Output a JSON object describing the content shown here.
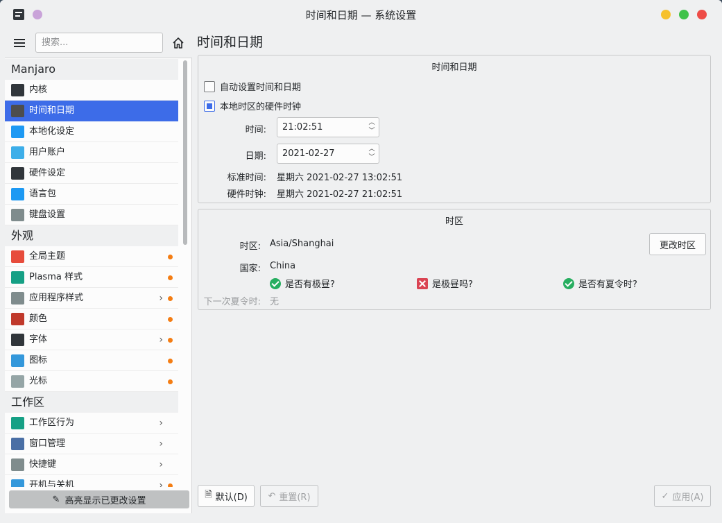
{
  "window": {
    "title": "时间和日期 — 系统设置"
  },
  "sidebar": {
    "search_placeholder": "搜索...",
    "sections": [
      {
        "header": "Manjaro",
        "items": [
          {
            "label": "内核",
            "icon": "kernel-icon",
            "color": "#31363b"
          },
          {
            "label": "时间和日期",
            "icon": "clock-icon",
            "color": "#4d4d4d",
            "selected": true
          },
          {
            "label": "本地化设定",
            "icon": "locale-chat-icon",
            "color": "#1d99f3"
          },
          {
            "label": "用户账户",
            "icon": "user-icon",
            "color": "#3daee9"
          },
          {
            "label": "硬件设定",
            "icon": "hardware-icon",
            "color": "#31363b"
          },
          {
            "label": "语言包",
            "icon": "language-chat-icon",
            "color": "#1d99f3"
          },
          {
            "label": "键盘设置",
            "icon": "keyboard-icon",
            "color": "#7f8c8d"
          }
        ]
      },
      {
        "header": "外观",
        "items": [
          {
            "label": "全局主题",
            "icon": "global-theme-icon",
            "color": "#e74c3c",
            "changed": true
          },
          {
            "label": "Plasma 样式",
            "icon": "plasma-style-icon",
            "color": "#16a085",
            "changed": true
          },
          {
            "label": "应用程序样式",
            "icon": "app-style-icon",
            "color": "#7f8c8d",
            "chevron": true,
            "changed": true
          },
          {
            "label": "颜色",
            "icon": "colors-icon",
            "color": "#c0392b",
            "changed": true
          },
          {
            "label": "字体",
            "icon": "fonts-icon",
            "color": "#31363b",
            "chevron": true,
            "changed": true
          },
          {
            "label": "图标",
            "icon": "icons-icon",
            "color": "#3498db",
            "changed": true
          },
          {
            "label": "光标",
            "icon": "cursor-icon",
            "color": "#95a5a6",
            "changed": true
          }
        ]
      },
      {
        "header": "工作区",
        "items": [
          {
            "label": "工作区行为",
            "icon": "workspace-behavior-icon",
            "color": "#16a085",
            "chevron": true
          },
          {
            "label": "窗口管理",
            "icon": "window-management-icon",
            "color": "#4a6fa5",
            "chevron": true
          },
          {
            "label": "快捷键",
            "icon": "shortcuts-icon",
            "color": "#7f8c8d",
            "chevron": true
          },
          {
            "label": "开机与关机",
            "icon": "startup-shutdown-icon",
            "color": "#3498db",
            "chevron": true,
            "changed": true
          }
        ]
      }
    ],
    "highlight_changed_label": "高亮显示已更改设置"
  },
  "main": {
    "page_title": "时间和日期",
    "datetime_group": {
      "title": "时间和日期",
      "auto_set_label": "自动设置时间和日期",
      "auto_set_checked": false,
      "local_rtc_label": "本地时区的硬件时钟",
      "local_rtc_checked": true,
      "time_label": "时间:",
      "time_value": "21:02:51",
      "date_label": "日期:",
      "date_value": "2021-02-27",
      "utc_label": "标准时间:",
      "utc_value": "星期六 2021-02-27 13:02:51",
      "rtc_label": "硬件时钟:",
      "rtc_value": "星期六 2021-02-27 21:02:51"
    },
    "timezone_group": {
      "title": "时区",
      "tz_label": "时区:",
      "tz_value": "Asia/Shanghai",
      "change_tz_button": "更改时区",
      "country_label": "国家:",
      "country_value": "China",
      "has_polar_day_label": "是否有极昼?",
      "is_polar_day_label": "是极昼吗?",
      "has_dst_label": "是否有夏令时?",
      "next_dst_label": "下一次夏令时:",
      "next_dst_value": "无"
    },
    "footer": {
      "defaults_button": "默认(D)",
      "reset_button": "重置(R)",
      "apply_button": "应用(A)"
    }
  }
}
